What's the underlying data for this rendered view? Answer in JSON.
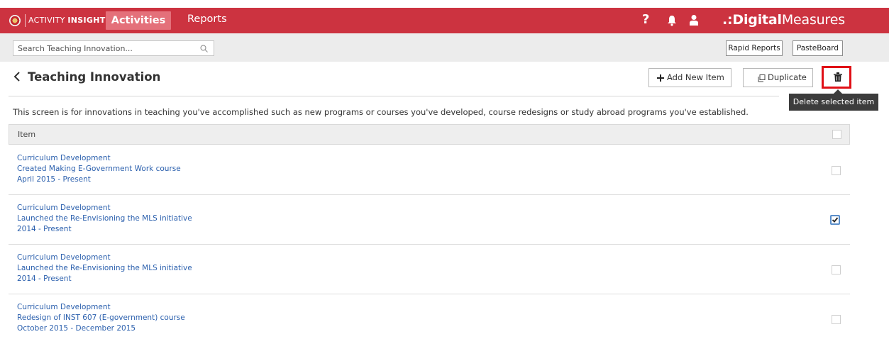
{
  "nav": {
    "brand_light": "ACTIVITY",
    "brand_bold": "INSIGHT",
    "tabs": [
      {
        "label": "Activities",
        "active": true
      },
      {
        "label": "Reports",
        "active": false
      }
    ],
    "help_label": "?",
    "logo_dots": ".:",
    "logo_bold": "Digital",
    "logo_light": "Measures",
    "bar_color": "#cc3340"
  },
  "search": {
    "placeholder": "Search Teaching Innovation...",
    "rapid_reports_label": "Rapid Reports",
    "pasteboard_label": "PasteBoard"
  },
  "header": {
    "title": "Teaching Innovation",
    "add_new_label": "Add New Item",
    "duplicate_label": "Duplicate",
    "delete_tooltip": "Delete selected item"
  },
  "description": "This screen is for innovations in teaching you've accomplished such as new programs or courses you've developed, course redesigns or study abroad programs you've established.",
  "table": {
    "header_label": "Item",
    "rows": [
      {
        "category": "Curriculum Development",
        "title": "Created Making E-Government Work course",
        "dates": "April 2015 - Present",
        "checked": false
      },
      {
        "category": "Curriculum Development",
        "title": "Launched the Re-Envisioning the MLS initiative",
        "dates": "2014 - Present",
        "checked": true
      },
      {
        "category": "Curriculum Development",
        "title": "Launched the Re-Envisioning the MLS initiative",
        "dates": "2014 - Present",
        "checked": false
      },
      {
        "category": "Curriculum Development",
        "title": "Redesign of INST 607 (E-government) course",
        "dates": "October 2015 - December 2015",
        "checked": false
      }
    ]
  },
  "icons": [
    "university-seal-icon",
    "help-icon",
    "bell-icon",
    "user-icon",
    "search-icon",
    "back-chevron-icon",
    "plus-icon",
    "duplicate-icon",
    "trash-icon",
    "checkbox-icon",
    "checkmark-icon"
  ]
}
